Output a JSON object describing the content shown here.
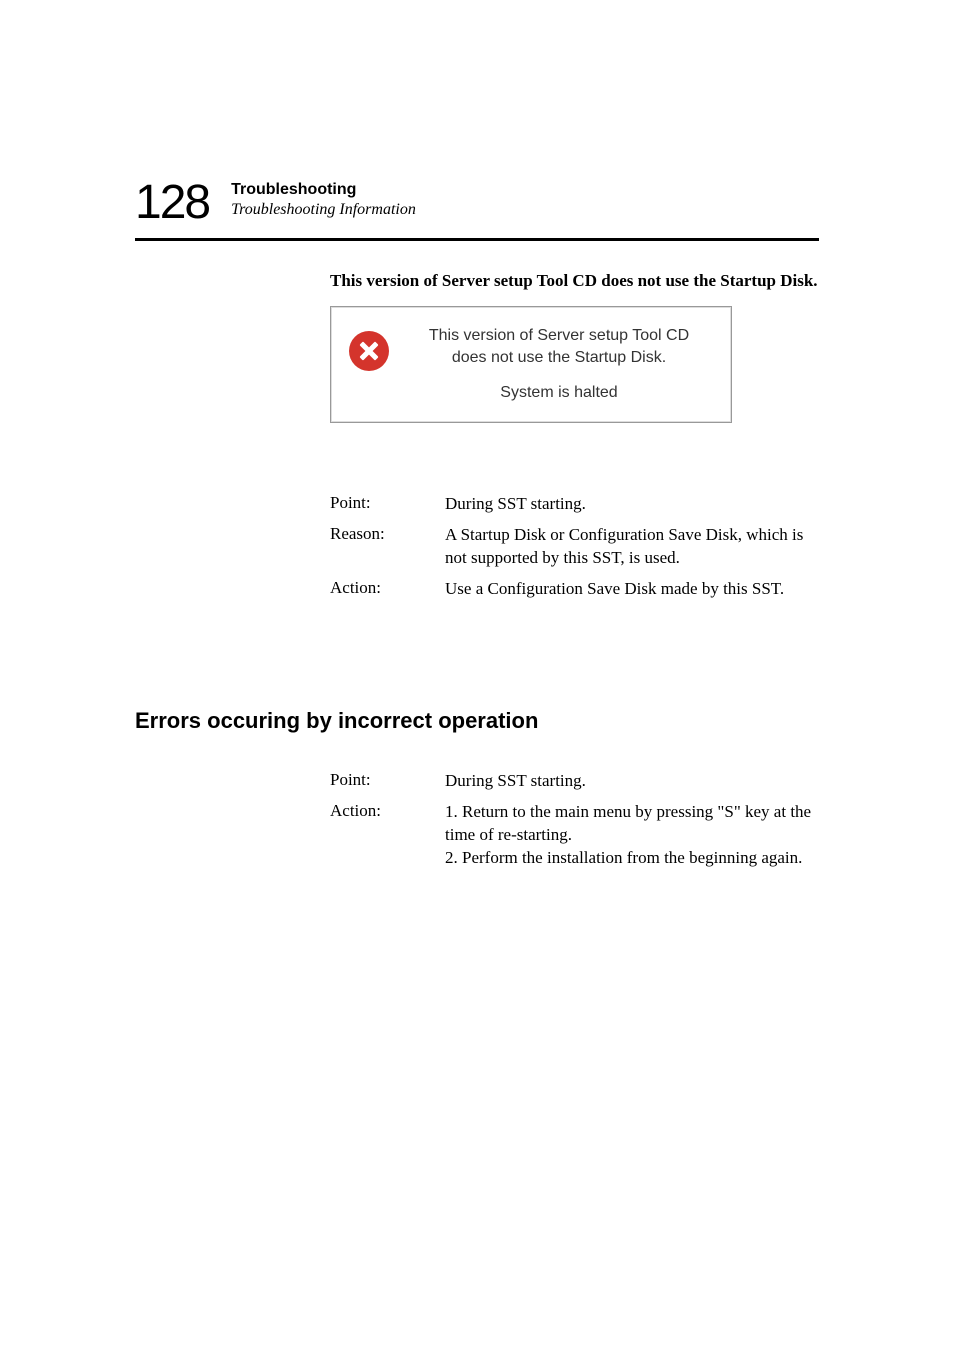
{
  "header": {
    "page_number": "128",
    "title": "Troubleshooting",
    "subtitle": "Troubleshooting Information"
  },
  "section1": {
    "intro": "This version of Server setup Tool CD does not use the Startup Disk.",
    "dialog": {
      "line1": "This version of Server setup Tool CD",
      "line2": "does not use the Startup Disk.",
      "line3": "System is halted"
    },
    "rows": [
      {
        "label": "Point:",
        "value": "During SST starting."
      },
      {
        "label": "Reason:",
        "value": "A Startup Disk or Configuration Save Disk, which is not supported by this SST, is used."
      },
      {
        "label": "Action:",
        "value": "Use a Configuration Save Disk made by this SST."
      }
    ]
  },
  "section2": {
    "heading": "Errors occuring by incorrect operation",
    "rows": [
      {
        "label": "Point:",
        "value": "During SST starting."
      },
      {
        "label": "Action:",
        "value": "1. Return to the main menu by pressing \"S\" key at the time of re-starting.\n2. Perform the installation from the beginning again."
      }
    ]
  }
}
